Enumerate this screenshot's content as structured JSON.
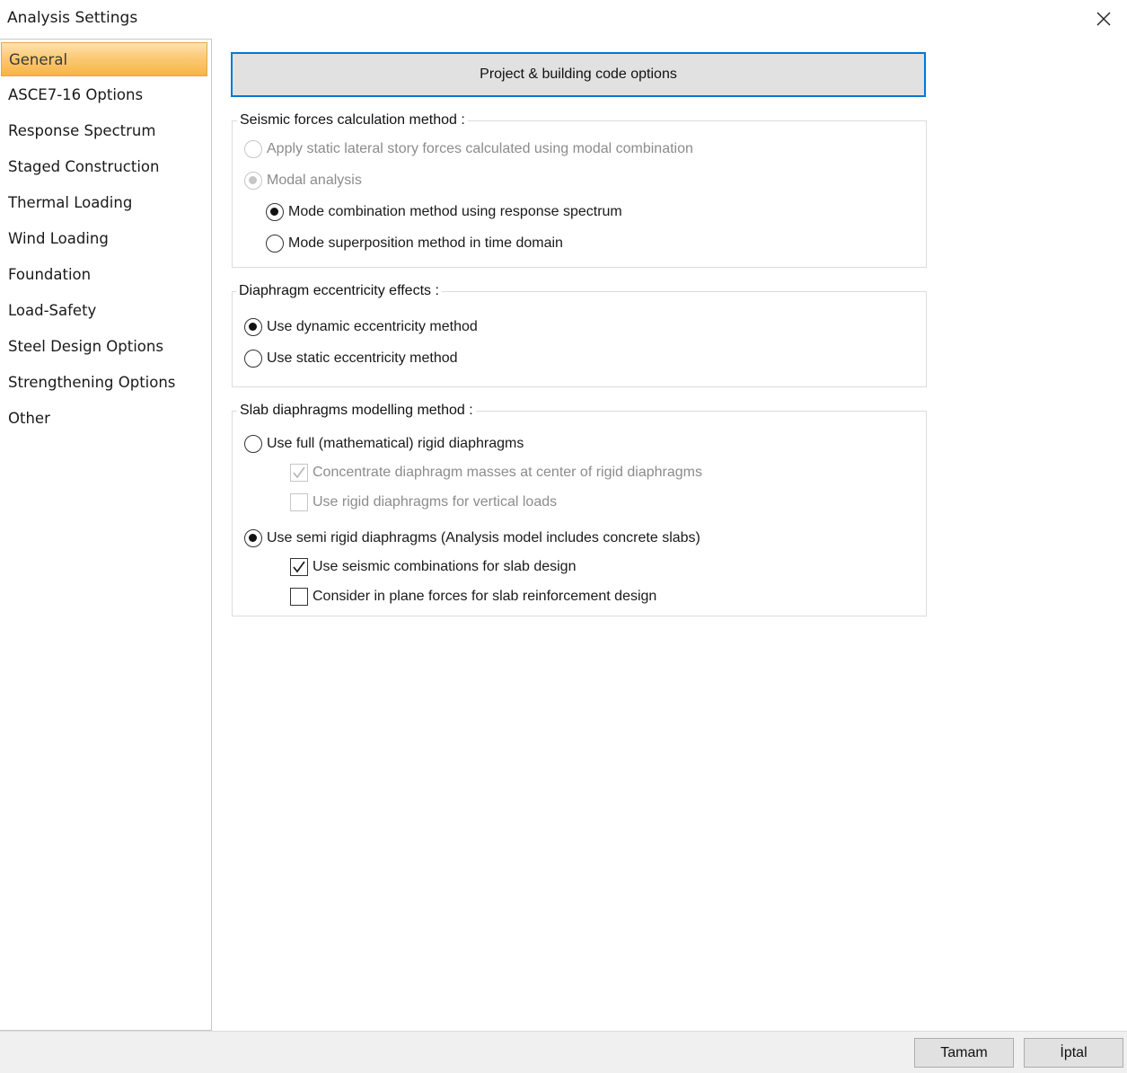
{
  "window": {
    "title": "Analysis Settings",
    "close_icon": "close-icon"
  },
  "sidebar": {
    "items": [
      {
        "label": "General",
        "active": true
      },
      {
        "label": "ASCE7-16 Options"
      },
      {
        "label": "Response Spectrum"
      },
      {
        "label": "Staged Construction"
      },
      {
        "label": "Thermal Loading"
      },
      {
        "label": "Wind Loading"
      },
      {
        "label": "Foundation"
      },
      {
        "label": "Load-Safety"
      },
      {
        "label": "Steel Design Options"
      },
      {
        "label": "Strengthening Options"
      },
      {
        "label": "Other"
      }
    ]
  },
  "main": {
    "project_button": "Project & building code options",
    "seismic": {
      "title": "Seismic forces calculation method :",
      "opt_static": "Apply static lateral story forces calculated using modal combination",
      "opt_modal": "Modal analysis",
      "opt_mode_combination": "Mode combination method using response spectrum",
      "opt_mode_superposition": "Mode superposition method in time domain"
    },
    "eccentricity": {
      "title": "Diaphragm eccentricity effects :",
      "opt_dynamic": "Use dynamic eccentricity method",
      "opt_static": "Use static eccentricity method"
    },
    "slab": {
      "title": "Slab diaphragms modelling method :",
      "opt_rigid": "Use full (mathematical) rigid diaphragms",
      "chk_concentrate": "Concentrate diaphragm masses at center of rigid diaphragms",
      "chk_vertical": "Use rigid diaphragms for vertical loads",
      "opt_semi_rigid": "Use semi rigid diaphragms (Analysis model includes concrete slabs)",
      "chk_seismic_combo": "Use seismic combinations for slab design",
      "chk_in_plane": "Consider in plane forces for slab reinforcement design"
    }
  },
  "footer": {
    "ok_label": "Tamam",
    "cancel_label": "İptal"
  },
  "colors": {
    "active_nav": "#f9bf5e",
    "focus_border": "#0078d7",
    "disabled_text": "#8c8c8c"
  }
}
